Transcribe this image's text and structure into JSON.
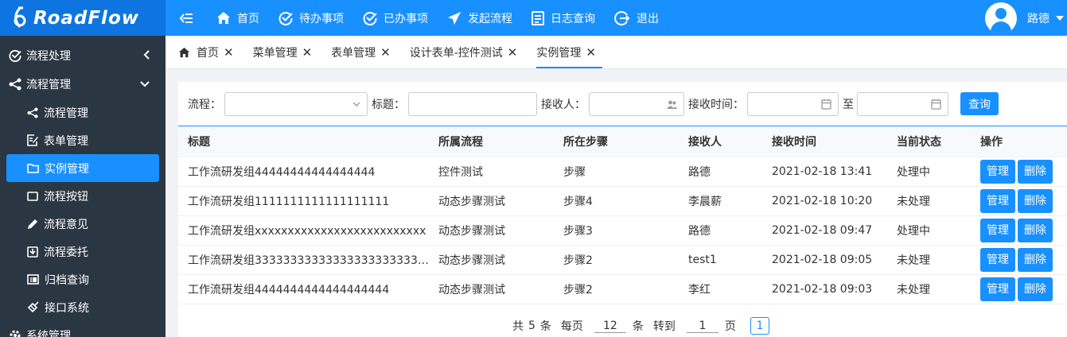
{
  "app": {
    "logo_text": "RoadFlow"
  },
  "topnav": [
    {
      "label": "首页",
      "icon": "home-icon"
    },
    {
      "label": "待办事项",
      "icon": "check-circle-icon"
    },
    {
      "label": "已办事项",
      "icon": "check-circle-icon"
    },
    {
      "label": "发起流程",
      "icon": "send-icon"
    },
    {
      "label": "日志查询",
      "icon": "document-icon"
    },
    {
      "label": "退出",
      "icon": "logout-icon"
    }
  ],
  "user": {
    "name": "路德"
  },
  "sidebar": {
    "groups": [
      {
        "label": "流程处理",
        "icon": "check-circle-icon",
        "expanded": false
      },
      {
        "label": "流程管理",
        "icon": "share-icon",
        "expanded": true
      },
      {
        "label": "系统管理",
        "icon": "gear-icon",
        "expanded": false
      }
    ],
    "items": [
      {
        "label": "流程管理",
        "icon": "share-icon"
      },
      {
        "label": "表单管理",
        "icon": "form-edit-icon"
      },
      {
        "label": "实例管理",
        "icon": "folder-icon",
        "active": true
      },
      {
        "label": "流程按钮",
        "icon": "square-icon"
      },
      {
        "label": "流程意见",
        "icon": "pencil-icon"
      },
      {
        "label": "流程委托",
        "icon": "inbox-icon"
      },
      {
        "label": "归档查询",
        "icon": "archive-icon"
      },
      {
        "label": "接口系统",
        "icon": "plug-icon"
      }
    ]
  },
  "tabs": [
    {
      "label": "首页",
      "icon": "home-icon"
    },
    {
      "label": "菜单管理"
    },
    {
      "label": "表单管理"
    },
    {
      "label": "设计表单-控件测试"
    },
    {
      "label": "实例管理",
      "active": true
    }
  ],
  "filter": {
    "flow_label": "流程：",
    "title_label": "标题：",
    "receiver_label": "接收人：",
    "time_label": "接收时间：",
    "to_label": "至",
    "query_label": "查询"
  },
  "table": {
    "columns": [
      "标题",
      "所属流程",
      "所在步骤",
      "接收人",
      "接收时间",
      "当前状态",
      "操作"
    ],
    "rows": [
      {
        "title": "工作流研发组44444444444444444",
        "flow": "控件测试",
        "step": "步骤",
        "receiver": "路德",
        "time": "2021-02-18 13:41",
        "status": "处理中"
      },
      {
        "title": "工作流研发组1111111111111111111",
        "flow": "动态步骤测试",
        "step": "步骤4",
        "receiver": "李晨薪",
        "time": "2021-02-18 10:20",
        "status": "未处理"
      },
      {
        "title": "工作流研发组xxxxxxxxxxxxxxxxxxxxxxxxxx",
        "flow": "动态步骤测试",
        "step": "步骤3",
        "receiver": "路德",
        "time": "2021-02-18 09:47",
        "status": "处理中"
      },
      {
        "title": "工作流研发组3333333333333333333333333...",
        "flow": "动态步骤测试",
        "step": "步骤2",
        "receiver": "test1",
        "time": "2021-02-18 09:05",
        "status": "未处理"
      },
      {
        "title": "工作流研发组4444444444444444444",
        "flow": "动态步骤测试",
        "step": "步骤2",
        "receiver": "李红",
        "time": "2021-02-18 09:03",
        "status": "未处理"
      }
    ],
    "manage_label": "管理",
    "delete_label": "删除"
  },
  "pager": {
    "total_prefix": "共",
    "total": "5",
    "total_suffix": "条",
    "per_page_label": "每页",
    "per_page": "12",
    "per_page_suffix": "条",
    "goto_label": "转到",
    "goto_page": "1",
    "goto_suffix": "页",
    "current_page": "1"
  },
  "colors": {
    "primary": "#1890ff",
    "sidebar_bg": "#2b3643",
    "logo_bg": "#0e75e0"
  }
}
